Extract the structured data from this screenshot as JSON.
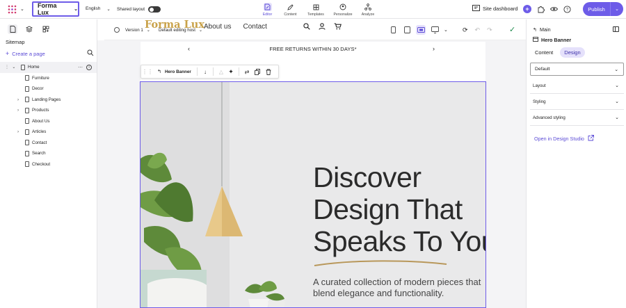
{
  "topbar": {
    "site_name": "Forma Lux",
    "language": "English",
    "shared_layout_label": "Shared layout",
    "nav_tabs": [
      {
        "label": "Editor",
        "icon": "editor-icon",
        "active": true
      },
      {
        "label": "Content",
        "icon": "pen-icon",
        "active": false
      },
      {
        "label": "Templates",
        "icon": "templates-icon",
        "active": false
      },
      {
        "label": "Personalize",
        "icon": "personalize-icon",
        "active": false
      },
      {
        "label": "Analyze",
        "icon": "analyze-icon",
        "active": false
      }
    ],
    "site_dashboard_label": "Site dashboard",
    "publish_label": "Publish"
  },
  "sitemap": {
    "title": "Sitemap",
    "create_page_label": "Create a page",
    "pages": [
      {
        "name": "Home",
        "level": 0,
        "expandable": true,
        "expanded": true,
        "selected": true
      },
      {
        "name": "Furniture",
        "level": 1,
        "expandable": false
      },
      {
        "name": "Decor",
        "level": 1,
        "expandable": false
      },
      {
        "name": "Landing Pages",
        "level": 1,
        "expandable": true
      },
      {
        "name": "Products",
        "level": 1,
        "expandable": true
      },
      {
        "name": "About Us",
        "level": 1,
        "expandable": false
      },
      {
        "name": "Articles",
        "level": 1,
        "expandable": true
      },
      {
        "name": "Contact",
        "level": 1,
        "expandable": false
      },
      {
        "name": "Search",
        "level": 1,
        "expandable": false
      },
      {
        "name": "Checkout",
        "level": 1,
        "expandable": false
      }
    ]
  },
  "editor_bar": {
    "version_label": "Version 1",
    "host_label": "Default editing host"
  },
  "preview": {
    "promo_text": "FREE RETURNS WITHIN 30 DAYS*",
    "brand": "Forma Lux",
    "nav_links": [
      "About us",
      "Contact"
    ],
    "floating_toolbar_label": "Hero Banner",
    "hero_title_lines": [
      "Discover",
      "Design That",
      "Speaks To You"
    ],
    "hero_subtitle": "A curated collection of modern pieces that blend elegance and functionality."
  },
  "properties": {
    "breadcrumb": "Main",
    "component_title": "Hero Banner",
    "tabs": [
      {
        "label": "Content",
        "active": false
      },
      {
        "label": "Design",
        "active": true
      }
    ],
    "variant_value": "Default",
    "sections": [
      "Layout",
      "Styling",
      "Advanced styling"
    ],
    "open_studio_label": "Open in Design Studio"
  },
  "colors": {
    "accent": "#6d5ce8",
    "brand_gold": "#c9a24a",
    "confirm_green": "#1e8a4c",
    "hero_bg": "#e9e9ea"
  }
}
